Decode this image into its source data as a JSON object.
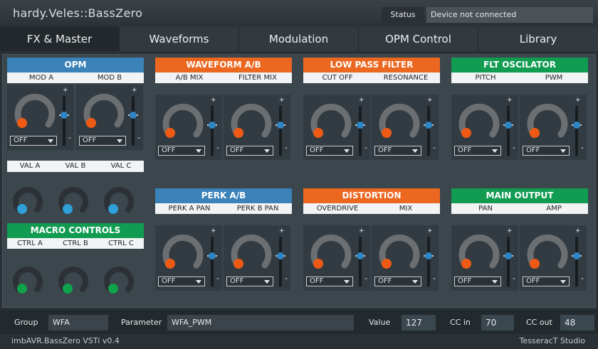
{
  "app": {
    "title": "hardy.Veles::BassZero"
  },
  "status": {
    "label": "Status",
    "value": "Device not connected"
  },
  "tabs": [
    {
      "label": "FX & Master"
    },
    {
      "label": "Waveforms"
    },
    {
      "label": "Modulation"
    },
    {
      "label": "OPM Control"
    },
    {
      "label": "Library"
    }
  ],
  "sections": {
    "opm": {
      "title": "OPM",
      "labels": [
        "MOD A",
        "MOD B"
      ]
    },
    "waveform_ab": {
      "title": "WAVEFORM A/B",
      "labels": [
        "A/B MIX",
        "FILTER MIX"
      ]
    },
    "low_pass_filter": {
      "title": "LOW PASS FILTER",
      "labels": [
        "CUT OFF",
        "RESONANCE"
      ]
    },
    "flt_oscilator": {
      "title": "FLT OSCILATOR",
      "labels": [
        "PITCH",
        "PWM"
      ]
    },
    "perk_ab": {
      "title": "PERK A/B",
      "labels": [
        "PERK A PAN",
        "PERK B PAN"
      ]
    },
    "distortion": {
      "title": "DISTORTION",
      "labels": [
        "OVERDRIVE",
        "MIX"
      ]
    },
    "main_output": {
      "title": "MAIN OUTPUT",
      "labels": [
        "PAN",
        "AMP"
      ]
    },
    "macro_controls": {
      "title": "MACRO CONTROLS",
      "labels": [
        "CTRL A",
        "CTRL B",
        "CTRL C"
      ]
    },
    "val": {
      "labels": [
        "VAL A",
        "VAL B",
        "VAL C"
      ]
    }
  },
  "dropdown_default": "OFF",
  "slider_signs": {
    "plus": "+",
    "minus": "-"
  },
  "colors": {
    "orange": "#ec6720",
    "blue": "#3a82b7",
    "green": "#129c52",
    "knob_orange": "#ee5a14",
    "knob_blue": "#2f9fd8",
    "knob_green": "#0fa24a"
  },
  "bottom": {
    "group_label": "Group",
    "group_value": "WFA",
    "parameter_label": "Parameter",
    "parameter_value": "WFA_PWM",
    "value_label": "Value",
    "value": "127",
    "cc_in_label": "CC in",
    "cc_in": "70",
    "cc_out_label": "CC out",
    "cc_out": "48"
  },
  "footer": {
    "left": "imbAVR.BassZero VSTi v0.4",
    "right": "TesseracT Studio"
  }
}
